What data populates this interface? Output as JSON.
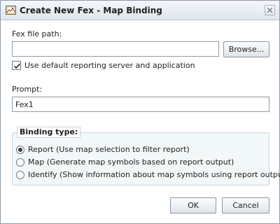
{
  "window": {
    "title": "Create New Fex - Map Binding"
  },
  "form": {
    "fex_path_label": "Fex file path:",
    "fex_path_value": "",
    "browse_label": "Browse...",
    "use_default": {
      "label": "Use default reporting server and application",
      "checked": true
    },
    "prompt_label": "Prompt:",
    "prompt_value": "Fex1"
  },
  "binding": {
    "legend": "Binding type:",
    "options": [
      {
        "label": "Report (Use map selection to filter report)",
        "selected": true
      },
      {
        "label": "Map (Generate map symbols based on report output)",
        "selected": false
      },
      {
        "label": "Identify (Show information about map symbols using report output)",
        "selected": false
      }
    ]
  },
  "buttons": {
    "ok": "OK",
    "cancel": "Cancel"
  },
  "icons": {
    "title": "map-binding-icon",
    "close": "close-icon",
    "check": "check-icon"
  }
}
